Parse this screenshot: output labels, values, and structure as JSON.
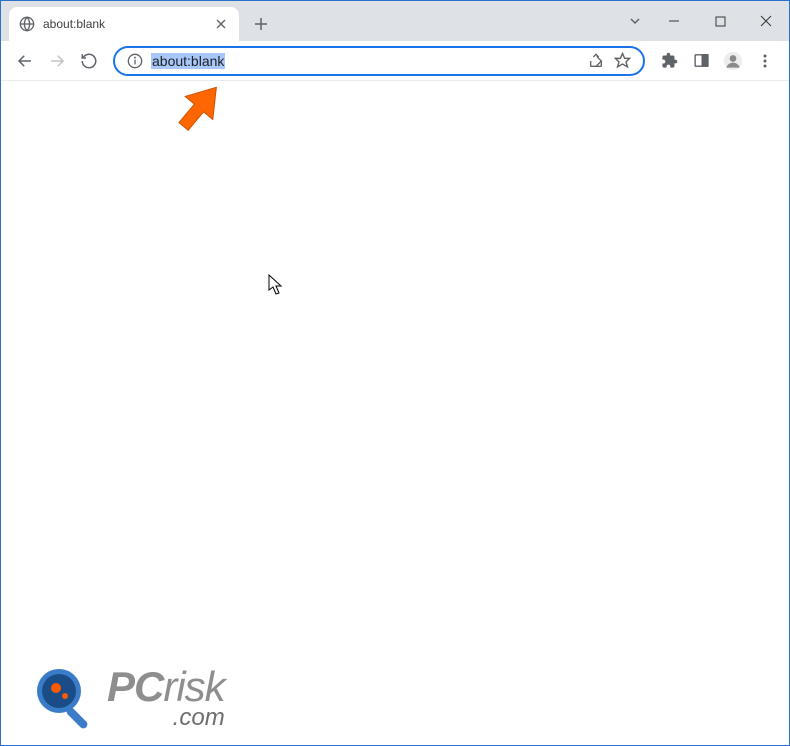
{
  "tab": {
    "title": "about:blank"
  },
  "address_bar": {
    "url": "about:blank",
    "selected": true
  },
  "watermark": {
    "text_pc": "PC",
    "text_risk": "risk",
    "text_com": ".com"
  },
  "icons": {
    "globe": "globe-icon",
    "close": "close-icon",
    "plus": "plus-icon",
    "chevron_down": "chevron-down-icon",
    "minimize": "minimize-icon",
    "maximize": "maximize-icon",
    "window_close": "window-close-icon",
    "back": "back-icon",
    "forward": "forward-icon",
    "reload": "reload-icon",
    "info": "info-icon",
    "share": "share-icon",
    "star": "star-icon",
    "extensions": "extensions-icon",
    "sidepanel": "sidepanel-icon",
    "profile": "profile-icon",
    "menu": "menu-icon"
  }
}
